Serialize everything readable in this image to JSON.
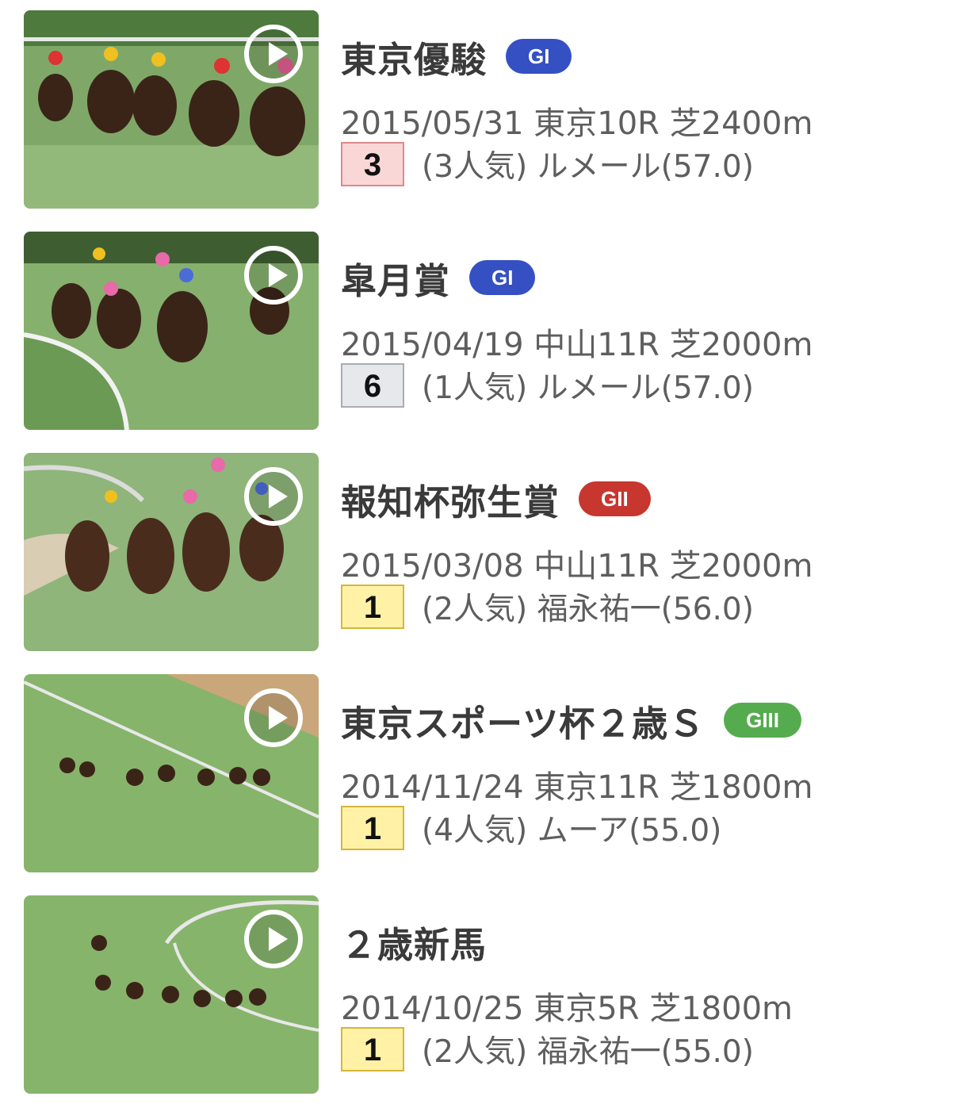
{
  "colors": {
    "G1": "#3550c2",
    "G2": "#c7362f",
    "G3": "#55ac4f"
  },
  "races": [
    {
      "name": "東京優駿",
      "grade": "GI",
      "grade_class": "G1",
      "meta": "2015/05/31 東京10R 芝2400m",
      "rank": "3",
      "rank_style": "third",
      "result": "(3人気) ルメール(57.0)",
      "thumb_icon": "play-icon"
    },
    {
      "name": "皐月賞",
      "grade": "GI",
      "grade_class": "G1",
      "meta": "2015/04/19 中山11R 芝2000m",
      "rank": "6",
      "rank_style": "other",
      "result": "(1人気) ルメール(57.0)",
      "thumb_icon": "play-icon"
    },
    {
      "name": "報知杯弥生賞",
      "grade": "GII",
      "grade_class": "G2",
      "meta": "2015/03/08 中山11R 芝2000m",
      "rank": "1",
      "rank_style": "first",
      "result": "(2人気) 福永祐一(56.0)",
      "thumb_icon": "play-icon"
    },
    {
      "name": "東京スポーツ杯２歳Ｓ",
      "grade": "GIII",
      "grade_class": "G3",
      "meta": "2014/11/24 東京11R 芝1800m",
      "rank": "1",
      "rank_style": "first",
      "result": "(4人気) ムーア(55.0)",
      "thumb_icon": "play-icon"
    },
    {
      "name": "２歳新馬",
      "grade": "",
      "grade_class": "",
      "meta": "2014/10/25 東京5R 芝1800m",
      "rank": "1",
      "rank_style": "first",
      "result": "(2人気) 福永祐一(55.0)",
      "thumb_icon": "play-icon"
    }
  ]
}
